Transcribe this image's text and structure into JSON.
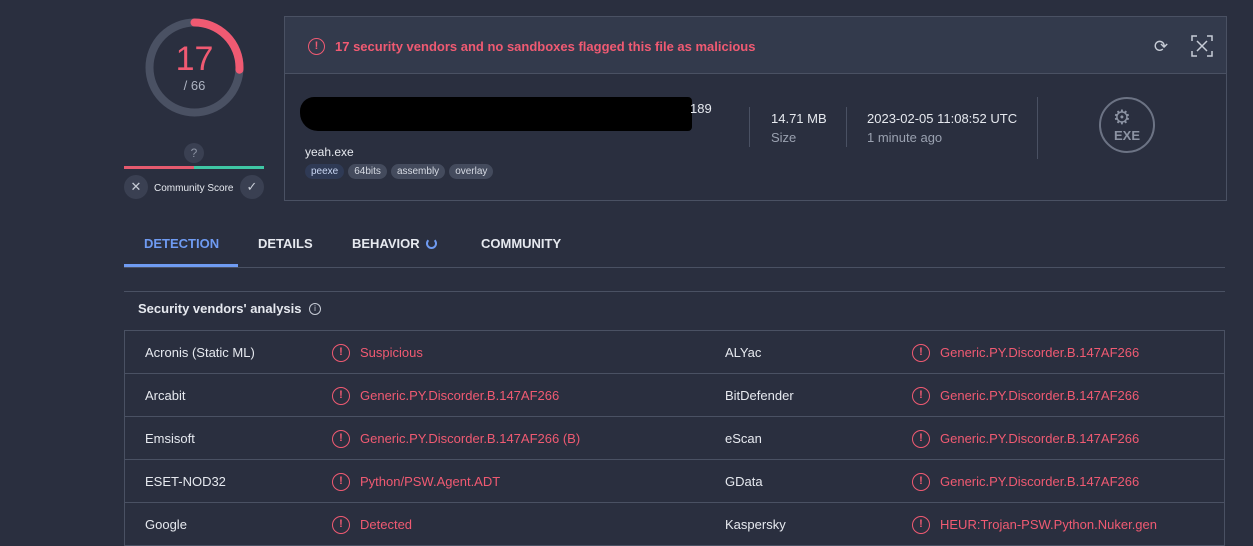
{
  "score": {
    "detected": "17",
    "total": "/ 66",
    "ring_fraction": 0.2576,
    "ring_color": "#f05a72"
  },
  "community": {
    "question": "?",
    "label": "Community Score"
  },
  "alert": {
    "text": "17 security vendors and no sandboxes flagged this file as malicious"
  },
  "file": {
    "hash_tail": "189",
    "name": "yeah.exe",
    "tags": [
      "peexe",
      "64bits",
      "assembly",
      "overlay"
    ],
    "size_value": "14.71 MB",
    "size_label": "Size",
    "date_value": "2023-02-05 11:08:52 UTC",
    "date_label": "1 minute ago",
    "type_icon_text": "EXE"
  },
  "tabs": [
    "DETECTION",
    "DETAILS",
    "BEHAVIOR",
    "COMMUNITY"
  ],
  "vendors": {
    "title": "Security vendors' analysis",
    "rows": [
      {
        "left_name": "Acronis (Static ML)",
        "left_result": "Suspicious",
        "right_name": "ALYac",
        "right_result": "Generic.PY.Discorder.B.147AF266"
      },
      {
        "left_name": "Arcabit",
        "left_result": "Generic.PY.Discorder.B.147AF266",
        "right_name": "BitDefender",
        "right_result": "Generic.PY.Discorder.B.147AF266"
      },
      {
        "left_name": "Emsisoft",
        "left_result": "Generic.PY.Discorder.B.147AF266 (B)",
        "right_name": "eScan",
        "right_result": "Generic.PY.Discorder.B.147AF266"
      },
      {
        "left_name": "ESET-NOD32",
        "left_result": "Python/PSW.Agent.ADT",
        "right_name": "GData",
        "right_result": "Generic.PY.Discorder.B.147AF266"
      },
      {
        "left_name": "Google",
        "left_result": "Detected",
        "right_name": "Kaspersky",
        "right_result": "HEUR:Trojan-PSW.Python.Nuker.gen"
      }
    ]
  }
}
